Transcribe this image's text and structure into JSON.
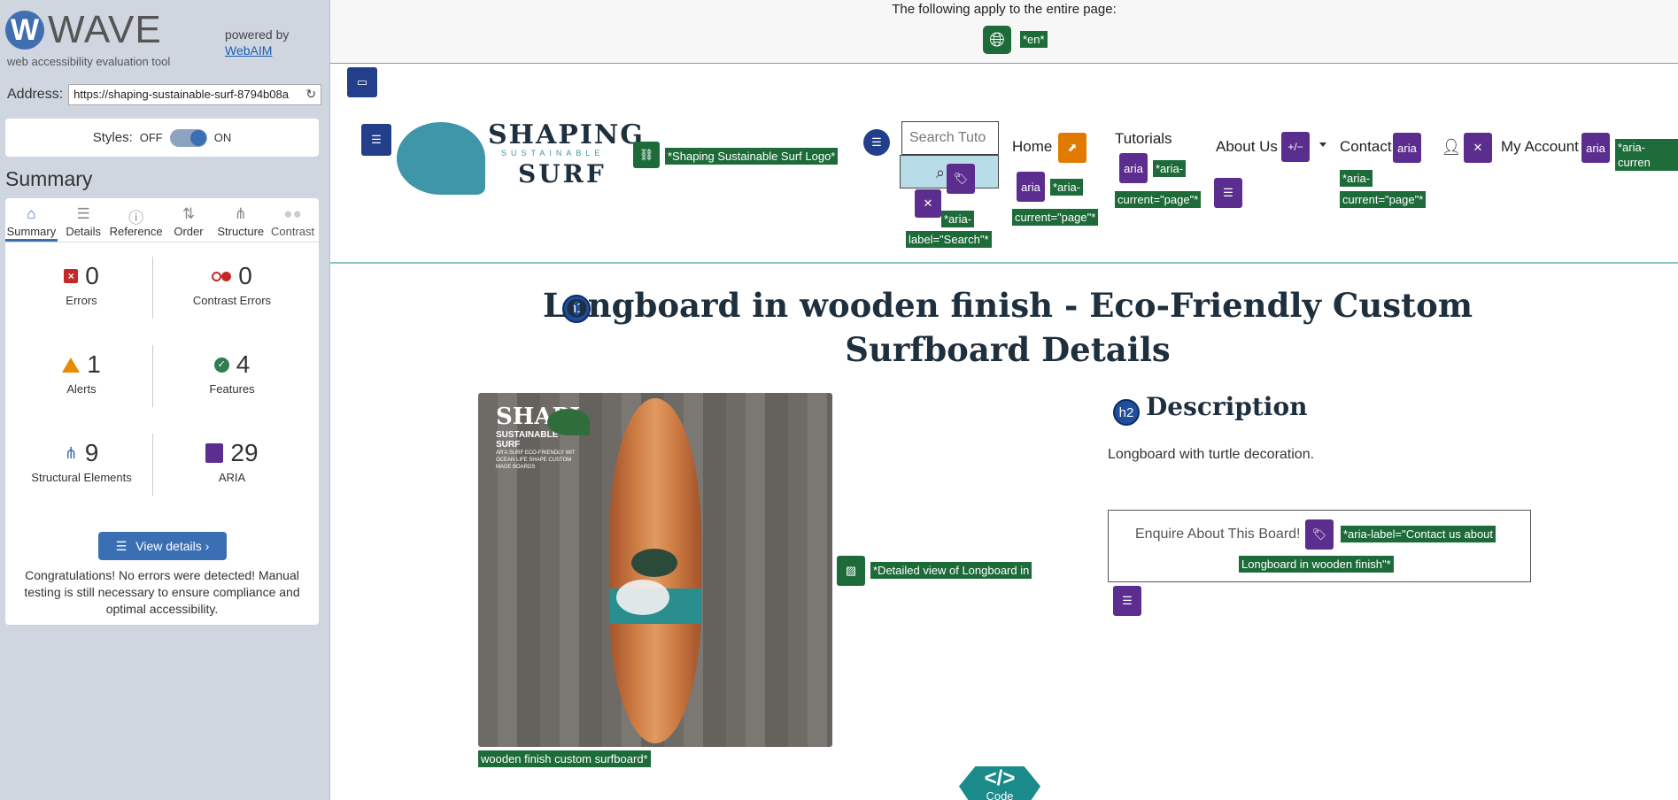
{
  "wave": {
    "logo_letter": "W",
    "logo_word": "WAVE",
    "subtitle": "web accessibility evaluation tool",
    "powered_by": "powered by",
    "webaim_link": "WebAIM",
    "address_label": "Address:",
    "address_value": "https://shaping-sustainable-surf-8794b08a",
    "styles_label": "Styles:",
    "styles_off": "OFF",
    "styles_on": "ON",
    "summary_title": "Summary",
    "tabs": [
      {
        "label": "Summary",
        "icon": "home-icon"
      },
      {
        "label": "Details",
        "icon": "list-icon"
      },
      {
        "label": "Reference",
        "icon": "info-icon"
      },
      {
        "label": "Order",
        "icon": "order-icon"
      },
      {
        "label": "Structure",
        "icon": "structure-icon"
      },
      {
        "label": "Contrast",
        "icon": "contrast-icon"
      }
    ],
    "stats": {
      "errors": {
        "count": "0",
        "label": "Errors"
      },
      "contrast_errors": {
        "count": "0",
        "label": "Contrast Errors"
      },
      "alerts": {
        "count": "1",
        "label": "Alerts"
      },
      "features": {
        "count": "4",
        "label": "Features"
      },
      "structural": {
        "count": "9",
        "label": "Structural Elements"
      },
      "aria": {
        "count": "29",
        "label": "ARIA"
      }
    },
    "view_details": "View details ›",
    "congrats": "Congratulations! No errors were detected! Manual testing is still necessary to ensure compliance and optimal accessibility."
  },
  "page": {
    "banner_text": "The following apply to the entire page:",
    "lang_label": "*en*",
    "logo_alt_label": "*Shaping Sustainable Surf Logo*",
    "logo_main": "SHAPING",
    "logo_sub": "SUSTAINABLE",
    "logo_surf": "SURF",
    "search_placeholder": "Search Tuto",
    "search_aria_label_1": "*aria-",
    "search_aria_label_2": "label=\"Search\"*",
    "nav": {
      "home": "Home",
      "tutorials": "Tutorials",
      "about": "About Us",
      "contact": "Contact",
      "account": "My Account"
    },
    "aria_icon_text": "aria",
    "plusminus_text": "+/−",
    "aria_current_1": "*aria-",
    "aria_current_2": "current=\"page\"*",
    "aria_current_partial": "*aria-curren",
    "h1_badge": "h1",
    "h1": "Longboard in wooden finish - Eco-Friendly Custom Surfboard Details",
    "h2_badge": "h2",
    "h2": "Description",
    "description": "Longboard with turtle decoration.",
    "enquire_text": "Enquire About This Board!",
    "enquire_aria_1": "*aria-label=\"Contact us about",
    "enquire_aria_2": "Longboard in wooden finish\"*",
    "img_alt_1": "*Detailed view of Longboard in",
    "img_alt_2": "wooden finish custom surfboard*",
    "img_logo_1": "SHAPI",
    "img_logo_2": "SUSTAINABLE SURF",
    "img_logo_3": "AR'A SURF ECO-FRIENDLY WIT OCEAN LIFE SHAPE CUSTOM MADE BOARDS",
    "code_label": "Code",
    "code_symbol": "</>"
  }
}
